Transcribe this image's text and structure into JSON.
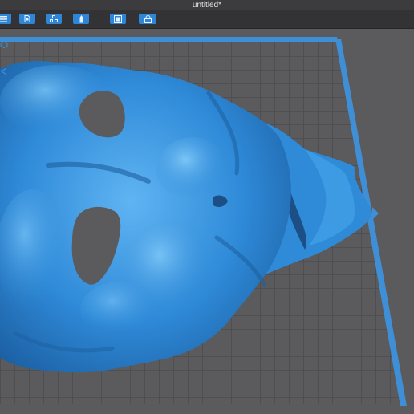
{
  "window": {
    "title": "untitled*"
  },
  "toolbar": {
    "buttons": [
      {
        "name": "open-menu-button",
        "icon": "menu-icon"
      },
      {
        "name": "open-file-button",
        "icon": "file-icon"
      },
      {
        "name": "arrange-button",
        "icon": "layout-icon"
      },
      {
        "name": "supports-button",
        "icon": "support-icon"
      },
      {
        "name": "frame-button",
        "icon": "frame-icon"
      },
      {
        "name": "lock-button",
        "icon": "lock-icon"
      }
    ]
  },
  "viewport": {
    "model": {
      "name": "mask-model",
      "color": "#2f8ad8"
    },
    "build_plate": {
      "edge_color": "#3f8fd6",
      "grid_color": "#4d4d4f",
      "floor_color": "#5b5b5d"
    }
  },
  "colors": {
    "accent": "#2f86d6",
    "titlebar": "#3c3c3e",
    "toolbar": "#333335"
  }
}
